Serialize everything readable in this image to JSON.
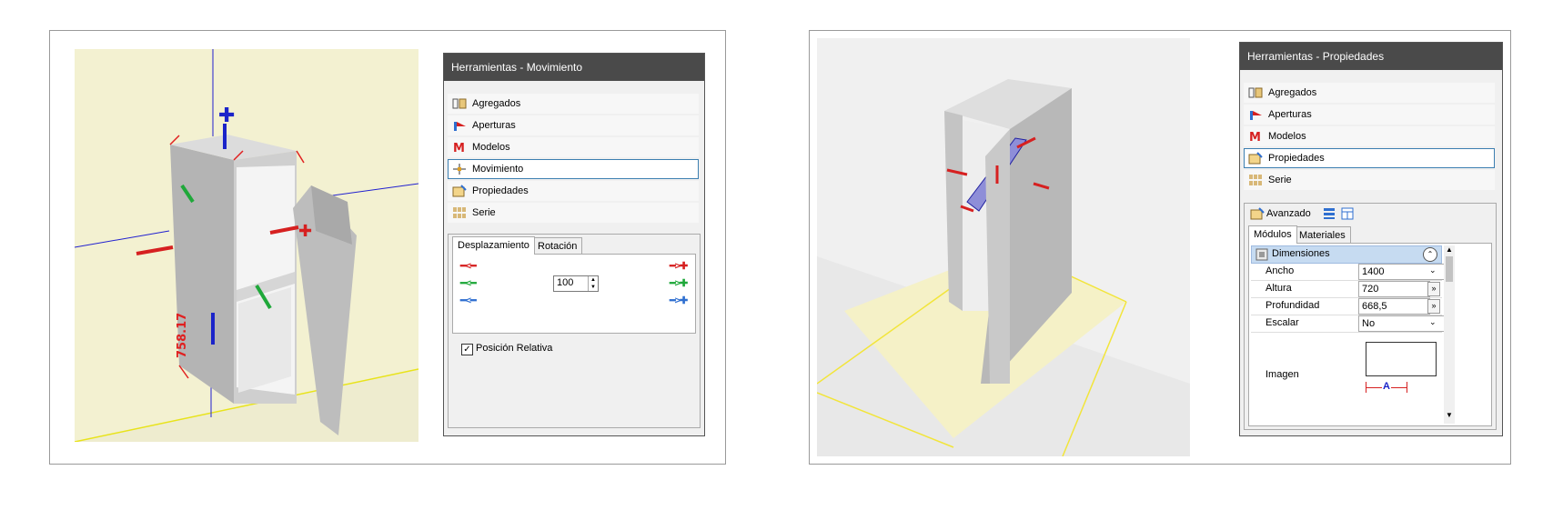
{
  "left_panel": {
    "title": "Herramientas - Movimiento",
    "menu": [
      {
        "label": "Agregados",
        "icon": "agregados-icon"
      },
      {
        "label": "Aperturas",
        "icon": "aperturas-icon"
      },
      {
        "label": "Modelos",
        "icon": "modelos-icon"
      },
      {
        "label": "Movimiento",
        "icon": "movimiento-icon"
      },
      {
        "label": "Propiedades",
        "icon": "propiedades-icon"
      },
      {
        "label": "Serie",
        "icon": "serie-icon"
      }
    ],
    "tabs": [
      "Desplazamiento",
      "Rotación"
    ],
    "step_value": "100",
    "checkbox_label": "Posición Relativa",
    "colors": {
      "x": "#d62020",
      "y": "#1fa83a",
      "z": "#2f6fd0"
    }
  },
  "left_viewport": {
    "dimension_label": "758.17"
  },
  "right_panel": {
    "title": "Herramientas - Propiedades",
    "menu": [
      {
        "label": "Agregados",
        "icon": "agregados-icon"
      },
      {
        "label": "Aperturas",
        "icon": "aperturas-icon"
      },
      {
        "label": "Modelos",
        "icon": "modelos-icon"
      },
      {
        "label": "Propiedades",
        "icon": "propiedades-icon"
      },
      {
        "label": "Serie",
        "icon": "serie-icon"
      }
    ],
    "mode_label": "Avanzado",
    "tabs": [
      "Módulos",
      "Materiales"
    ],
    "section_title": "Dimensiones",
    "properties": [
      {
        "name": "Ancho",
        "value": "1400"
      },
      {
        "name": "Altura",
        "value": "720"
      },
      {
        "name": "Profundidad",
        "value": "668,5"
      },
      {
        "name": "Escalar",
        "value": "No"
      }
    ],
    "image_label": "Imagen",
    "image_caption": "A"
  }
}
